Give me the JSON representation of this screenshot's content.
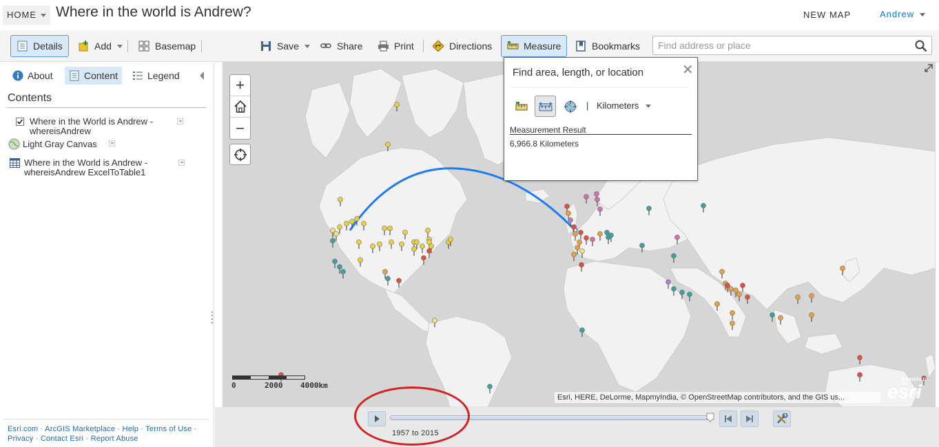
{
  "header": {
    "home_label": "HOME",
    "title": "Where in the world is Andrew?",
    "new_map_label": "NEW MAP",
    "user_name": "Andrew"
  },
  "toolbar": {
    "details": "Details",
    "add": "Add",
    "basemap": "Basemap",
    "save": "Save",
    "share": "Share",
    "print": "Print",
    "directions": "Directions",
    "measure": "Measure",
    "bookmarks": "Bookmarks",
    "search_placeholder": "Find address or place"
  },
  "panel": {
    "tabs": {
      "about": "About",
      "content": "Content",
      "legend": "Legend"
    },
    "contents_heading": "Contents",
    "layers": [
      {
        "line1": "Where in the World is Andrew -",
        "line2": "whereisAndrew",
        "checked": true
      },
      {
        "line1": "Light Gray Canvas",
        "line2": ""
      },
      {
        "line1": "Where in the World is Andrew -",
        "line2": "whereisAndrew ExcelToTable1"
      }
    ],
    "footer": {
      "esri": "Esri.com",
      "marketplace": "ArcGIS Marketplace",
      "help": "Help",
      "terms": "Terms of Use",
      "privacy": "Privacy",
      "contact": "Contact Esri",
      "abuse": "Report Abuse"
    }
  },
  "map": {
    "scale": {
      "zero": "0",
      "mid": "2000",
      "end": "4000km"
    },
    "attribution": "Esri, HERE, DeLorme, MapmyIndia, © OpenStreetMap contributors, and the GIS us...",
    "logo_top": "POWERED BY",
    "logo_name": "esri",
    "colors": {
      "land": "#f2f2f2",
      "water": "#d6d6d6",
      "measure_line": "#1e7cf0"
    }
  },
  "measure": {
    "title": "Find area, length, or location",
    "unit_sep": "|",
    "unit": "Kilometers",
    "result_label": "Measurement Result",
    "result_value": "6,966.8 Kilometers"
  },
  "time_slider": {
    "range": "1957 to 2015",
    "position": 1.0
  }
}
